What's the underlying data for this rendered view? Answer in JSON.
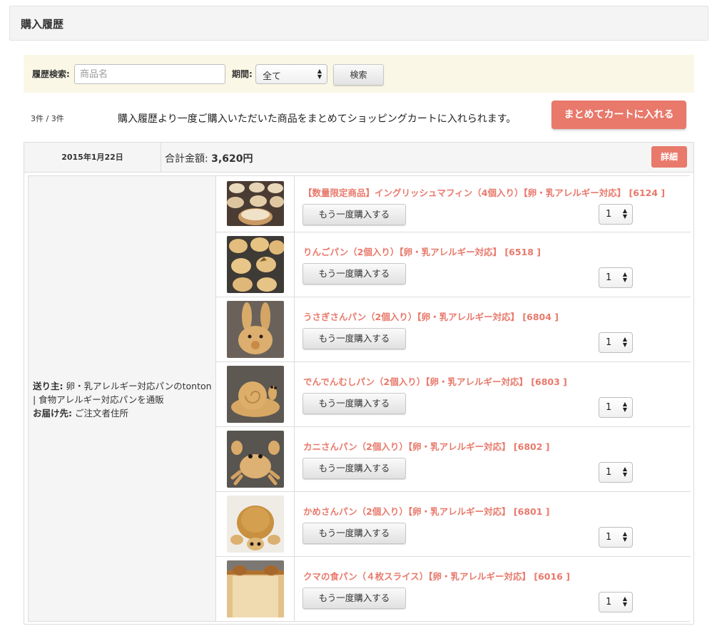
{
  "page": {
    "title": "購入履歴"
  },
  "search": {
    "history_label": "履歴検索:",
    "keyword_placeholder": "商品名",
    "keyword_value": "",
    "period_label": "期間:",
    "period_selected": "全て",
    "search_button": "検索"
  },
  "summary": {
    "count": "3件 / 3件",
    "message": "購入履歴より一度ご購入いただいた商品をまとめてショッピングカートに入れられます。",
    "bulk_cart_button": "まとめてカートに入れる"
  },
  "order": {
    "date": "2015年1月22日",
    "total_label": "合計金額:",
    "total_value": "3,620円",
    "detail_button": "詳細",
    "sender_label": "送り主:",
    "sender_value": "卵・乳アレルギー対応パンのtonton | 食物アレルギー対応パンを通販",
    "delivery_label": "お届け先:",
    "delivery_value": "ご注文者住所",
    "rebuy_label": "もう一度購入する",
    "items": [
      {
        "name": "【数量限定商品】イングリッシュマフィン（4個入り）【卵・乳アレルギー対応】 [6124 ]",
        "qty": "1",
        "image": "english-muffin-photo"
      },
      {
        "name": "りんごパン（2個入り）【卵・乳アレルギー対応】 [6518 ]",
        "qty": "1",
        "image": "apple-bread-photo"
      },
      {
        "name": "うさぎさんパン（2個入り）【卵・乳アレルギー対応】 [6804 ]",
        "qty": "1",
        "image": "rabbit-bread-photo"
      },
      {
        "name": "でんでんむしパン（2個入り）【卵・乳アレルギー対応】 [6803 ]",
        "qty": "1",
        "image": "snail-bread-photo"
      },
      {
        "name": "カニさんパン（2個入り）【卵・乳アレルギー対応】 [6802 ]",
        "qty": "1",
        "image": "crab-bread-photo"
      },
      {
        "name": "かめさんパン（2個入り）【卵・乳アレルギー対応】 [6801 ]",
        "qty": "1",
        "image": "turtle-bread-photo"
      },
      {
        "name": "クマの食パン（４枚スライス）【卵・乳アレルギー対応】 [6016 ]",
        "qty": "1",
        "image": "bear-loaf-photo"
      }
    ]
  },
  "colors": {
    "accent": "#e8796b",
    "search_panel": "#faf7e6",
    "header_bg": "#f4f4f4"
  }
}
